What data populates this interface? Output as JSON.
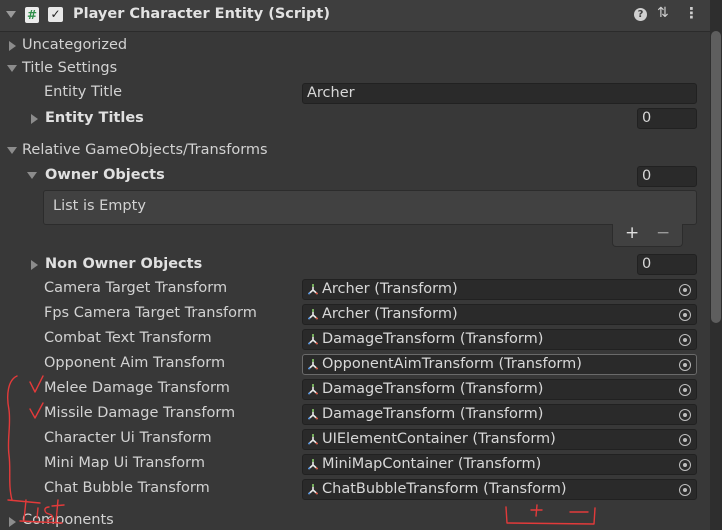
{
  "header": {
    "title": "Player Character Entity (Script)",
    "script_icon": "#",
    "checkbox": "✓",
    "help": "?",
    "preset": "⇅",
    "menu": "⋮"
  },
  "sections": {
    "uncategorized": "Uncategorized",
    "title_settings": "Title Settings",
    "relative": "Relative GameObjects/Transforms",
    "components": "Components"
  },
  "title_settings": {
    "entity_title_label": "Entity Title",
    "entity_title_value": "Archer",
    "entity_titles_label": "Entity Titles",
    "entity_titles_count": "0"
  },
  "owner_objects": {
    "label": "Owner Objects",
    "count": "0",
    "empty_text": "List is Empty",
    "add": "+",
    "remove": "−"
  },
  "non_owner_objects": {
    "label": "Non Owner Objects",
    "count": "0"
  },
  "transforms": [
    {
      "label": "Camera Target Transform",
      "value": "Archer (Transform)"
    },
    {
      "label": "Fps Camera Target Transform",
      "value": "Archer (Transform)"
    },
    {
      "label": "Combat Text Transform",
      "value": "DamageTransform (Transform)"
    },
    {
      "label": "Opponent Aim Transform",
      "value": "OpponentAimTransform (Transform)"
    },
    {
      "label": "Melee Damage Transform",
      "value": "DamageTransform (Transform)"
    },
    {
      "label": "Missile Damage Transform",
      "value": "DamageTransform (Transform)"
    },
    {
      "label": "Character Ui Transform",
      "value": "UIElementContainer (Transform)"
    },
    {
      "label": "Mini Map Ui Transform",
      "value": "MiniMapContainer (Transform)"
    },
    {
      "label": "Chat Bubble Transform",
      "value": "ChatBubbleTransform (Transform)"
    }
  ],
  "colors": {
    "background": "#383838",
    "field": "#2a2a2a",
    "annotation": "#e23a3a"
  },
  "icons": {
    "transform": "transform-icon",
    "picker": "object-picker-icon"
  }
}
